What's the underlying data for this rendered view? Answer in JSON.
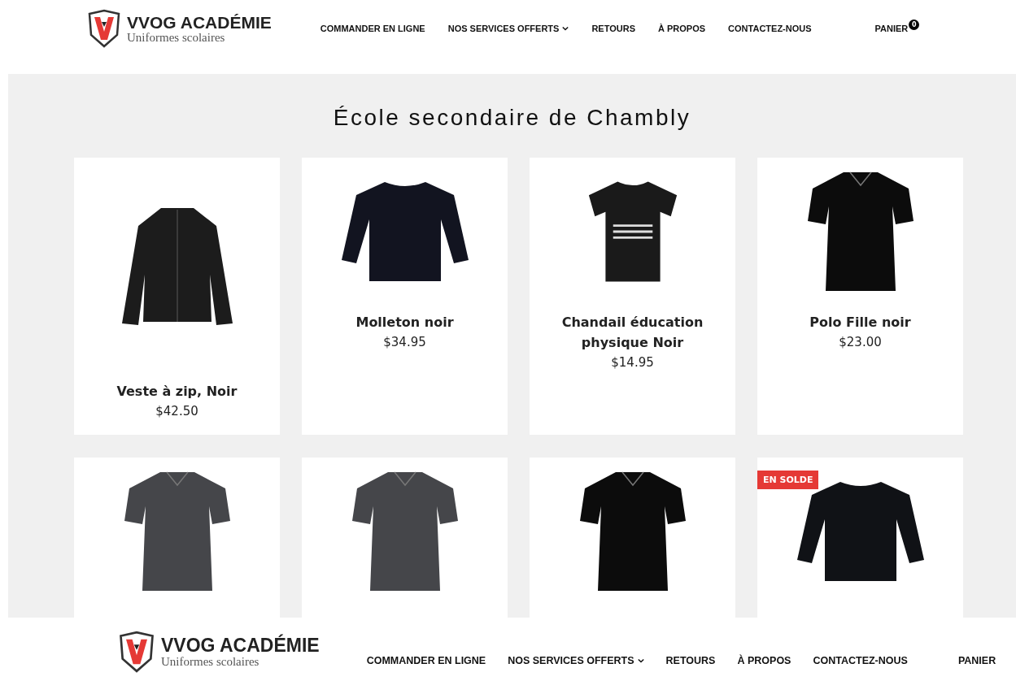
{
  "header": {
    "brand": "VVOG ACADÉMIE",
    "tagline": "Uniformes scolaires",
    "nav": [
      {
        "label": "COMMANDER EN LIGNE",
        "dropdown": false
      },
      {
        "label": "NOS SERVICES OFFERTS",
        "dropdown": true
      },
      {
        "label": "RETOURS",
        "dropdown": false
      },
      {
        "label": "À PROPOS",
        "dropdown": false
      },
      {
        "label": "CONTACTEZ-NOUS",
        "dropdown": false
      }
    ],
    "cart": {
      "label": "PANIER",
      "count": "0"
    }
  },
  "page_title": "École secondaire de Chambly",
  "products": [
    {
      "kind": "jacket",
      "color": "#1c1c1c",
      "name": "Veste à zip, Noir",
      "price": "$42.50"
    },
    {
      "kind": "sweatshirt",
      "color": "#121420",
      "name": "Molleton noir",
      "price": "$34.95"
    },
    {
      "kind": "tshirt",
      "color": "#1a1a1a",
      "name": "Chandail éducation physique Noir",
      "price": "$14.95"
    },
    {
      "kind": "polo",
      "color": "#0c0c0c",
      "name": "Polo Fille noir",
      "price": "$23.00"
    },
    {
      "kind": "polo",
      "color": "#45464a"
    },
    {
      "kind": "polo",
      "color": "#45464a"
    },
    {
      "kind": "polo",
      "color": "#0c0c0c"
    },
    {
      "kind": "sweatshirt",
      "color": "#101216",
      "badge": "EN SOLDE"
    }
  ],
  "sticky_header": {
    "brand": "VVOG ACADÉMIE",
    "tagline": "Uniformes scolaires",
    "nav": [
      {
        "label": "COMMANDER EN LIGNE",
        "dropdown": false
      },
      {
        "label": "NOS SERVICES OFFERTS",
        "dropdown": true
      },
      {
        "label": "RETOURS",
        "dropdown": false
      },
      {
        "label": "À PROPOS",
        "dropdown": false
      },
      {
        "label": "CONTACTEZ-NOUS",
        "dropdown": false
      }
    ],
    "cart": {
      "label": "PANIER"
    }
  }
}
